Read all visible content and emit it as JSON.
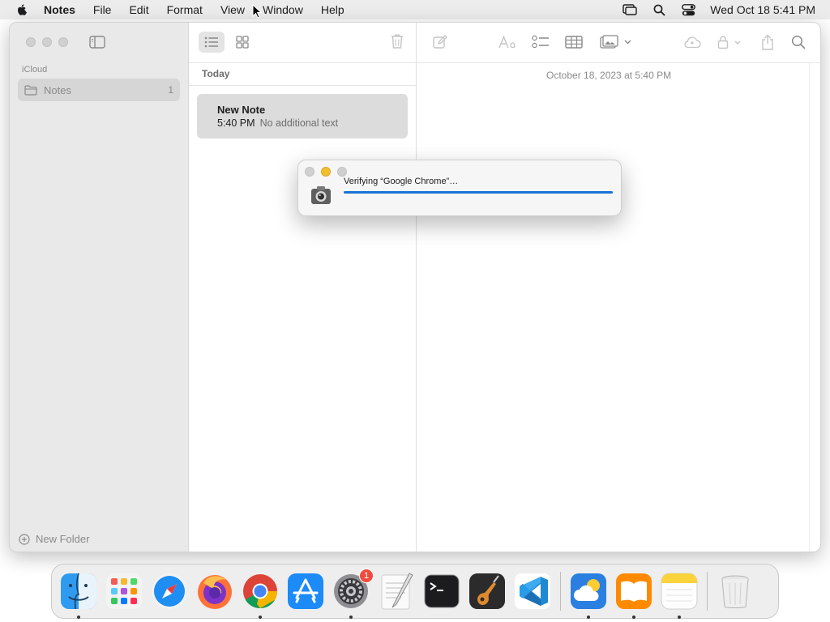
{
  "menubar": {
    "app_name": "Notes",
    "items": [
      "File",
      "Edit",
      "Format",
      "View",
      "Window",
      "Help"
    ],
    "clock": "Wed Oct 18  5:41 PM",
    "icons": [
      "screen-mirroring-icon",
      "spotlight-search-icon",
      "control-center-icon"
    ]
  },
  "sidebar": {
    "section_label": "iCloud",
    "folders": [
      {
        "name": "Notes",
        "count": "1"
      }
    ],
    "new_folder_label": "New Folder"
  },
  "note_list": {
    "group_header": "Today",
    "notes": [
      {
        "title": "New Note",
        "time": "5:40 PM",
        "preview": "No additional text"
      }
    ]
  },
  "editor": {
    "date": "October 18, 2023 at 5:40 PM"
  },
  "dialog": {
    "message": "Verifying “Google Chrome”…",
    "progress": 1.0,
    "accent": "#1a72d3"
  },
  "dock": {
    "apps": [
      {
        "name": "Finder",
        "icon": "finder-icon",
        "running": true
      },
      {
        "name": "Launchpad",
        "icon": "launchpad-icon",
        "running": false
      },
      {
        "name": "Safari",
        "icon": "safari-icon",
        "running": false
      },
      {
        "name": "Firefox",
        "icon": "firefox-icon",
        "running": false
      },
      {
        "name": "Google Chrome",
        "icon": "chrome-icon",
        "running": true
      },
      {
        "name": "App Store",
        "icon": "app-store-icon",
        "running": false
      },
      {
        "name": "System Settings",
        "icon": "settings-icon",
        "running": true,
        "badge": "1"
      },
      {
        "name": "TextEdit",
        "icon": "textedit-icon",
        "running": false
      },
      {
        "name": "Terminal",
        "icon": "terminal-icon",
        "running": false
      },
      {
        "name": "GarageBand",
        "icon": "garageband-icon",
        "running": false
      },
      {
        "name": "Visual Studio Code",
        "icon": "vscode-icon",
        "running": false
      },
      {
        "name": "Weather",
        "icon": "weather-icon",
        "running": true
      },
      {
        "name": "Books",
        "icon": "books-icon",
        "running": true
      },
      {
        "name": "Notes",
        "icon": "notes-icon",
        "running": true
      },
      {
        "name": "Trash",
        "icon": "trash-icon",
        "running": false
      }
    ]
  }
}
